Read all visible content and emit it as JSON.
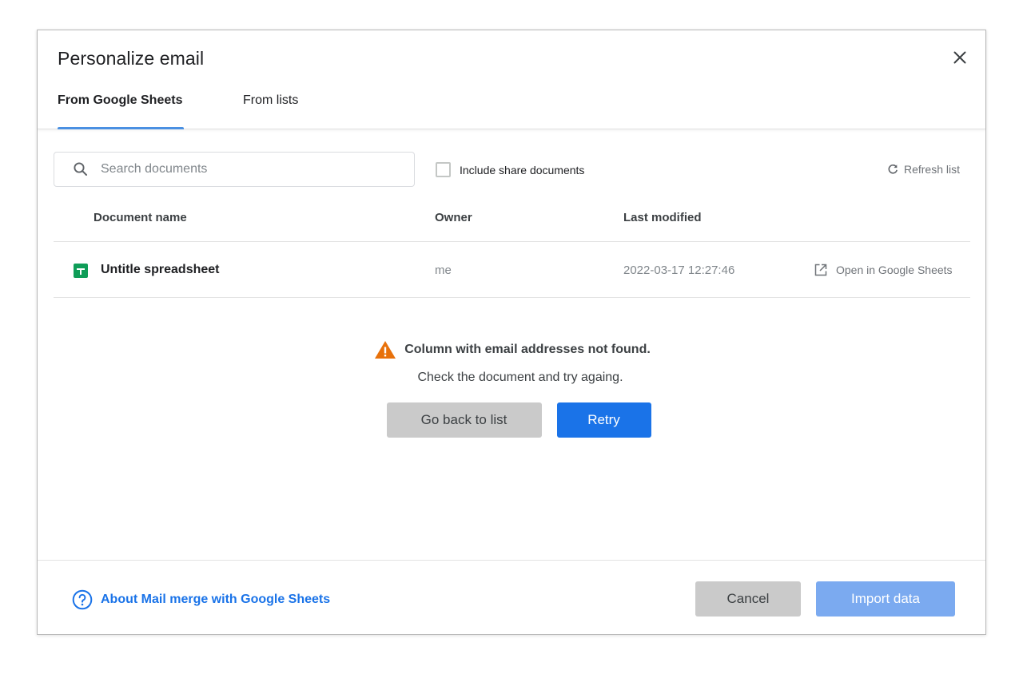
{
  "dialog": {
    "title": "Personalize email",
    "tabs": [
      {
        "label": "From Google Sheets",
        "active": true
      },
      {
        "label": "From lists",
        "active": false
      }
    ]
  },
  "toolbar": {
    "search_placeholder": "Search documents",
    "search_value": "",
    "include_shared_label": "Include share documents",
    "include_shared_checked": false,
    "refresh_label": "Refresh list"
  },
  "table": {
    "headers": [
      "Document name",
      "Owner",
      "Last modified"
    ],
    "rows": [
      {
        "name": "Untitle spreadsheet",
        "owner": "me",
        "last_modified": "2022-03-17 12:27:46",
        "action_label": "Open in Google Sheets"
      }
    ]
  },
  "error": {
    "title": "Column with email addresses not found.",
    "message": "Check the document and try againg.",
    "back_label": "Go back to list",
    "retry_label": "Retry"
  },
  "footer": {
    "help_label": "About Mail merge with Google Sheets",
    "cancel_label": "Cancel",
    "import_label": "Import data"
  },
  "colors": {
    "accent": "#1a73e8",
    "tab_underline": "#4a90e2",
    "warning": "#e8710a",
    "sheets_green": "#0f9d58",
    "disabled_primary": "#7baaf0"
  },
  "icons": [
    "close-icon",
    "search-icon",
    "refresh-icon",
    "sheets-icon",
    "open-external-icon",
    "warning-icon",
    "help-icon"
  ]
}
